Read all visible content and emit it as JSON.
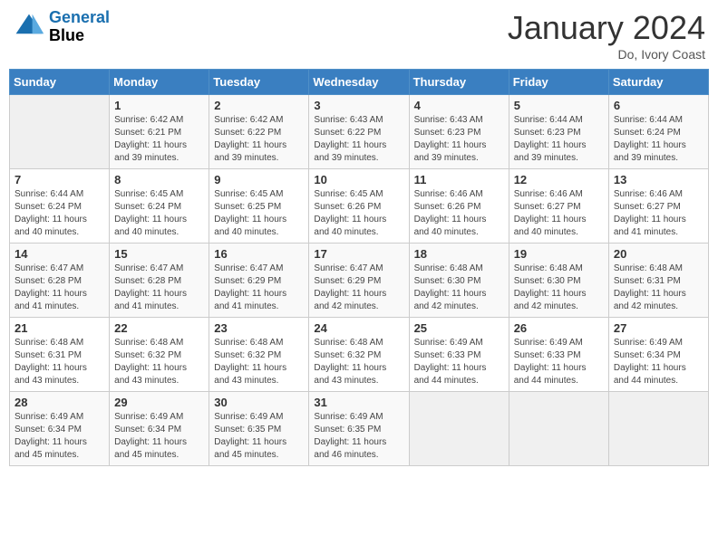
{
  "header": {
    "logo_line1": "General",
    "logo_line2": "Blue",
    "month_year": "January 2024",
    "location": "Do, Ivory Coast"
  },
  "days_of_week": [
    "Sunday",
    "Monday",
    "Tuesday",
    "Wednesday",
    "Thursday",
    "Friday",
    "Saturday"
  ],
  "weeks": [
    [
      {
        "day": "",
        "info": ""
      },
      {
        "day": "1",
        "info": "Sunrise: 6:42 AM\nSunset: 6:21 PM\nDaylight: 11 hours\nand 39 minutes."
      },
      {
        "day": "2",
        "info": "Sunrise: 6:42 AM\nSunset: 6:22 PM\nDaylight: 11 hours\nand 39 minutes."
      },
      {
        "day": "3",
        "info": "Sunrise: 6:43 AM\nSunset: 6:22 PM\nDaylight: 11 hours\nand 39 minutes."
      },
      {
        "day": "4",
        "info": "Sunrise: 6:43 AM\nSunset: 6:23 PM\nDaylight: 11 hours\nand 39 minutes."
      },
      {
        "day": "5",
        "info": "Sunrise: 6:44 AM\nSunset: 6:23 PM\nDaylight: 11 hours\nand 39 minutes."
      },
      {
        "day": "6",
        "info": "Sunrise: 6:44 AM\nSunset: 6:24 PM\nDaylight: 11 hours\nand 39 minutes."
      }
    ],
    [
      {
        "day": "7",
        "info": "Sunrise: 6:44 AM\nSunset: 6:24 PM\nDaylight: 11 hours\nand 40 minutes."
      },
      {
        "day": "8",
        "info": "Sunrise: 6:45 AM\nSunset: 6:24 PM\nDaylight: 11 hours\nand 40 minutes."
      },
      {
        "day": "9",
        "info": "Sunrise: 6:45 AM\nSunset: 6:25 PM\nDaylight: 11 hours\nand 40 minutes."
      },
      {
        "day": "10",
        "info": "Sunrise: 6:45 AM\nSunset: 6:26 PM\nDaylight: 11 hours\nand 40 minutes."
      },
      {
        "day": "11",
        "info": "Sunrise: 6:46 AM\nSunset: 6:26 PM\nDaylight: 11 hours\nand 40 minutes."
      },
      {
        "day": "12",
        "info": "Sunrise: 6:46 AM\nSunset: 6:27 PM\nDaylight: 11 hours\nand 40 minutes."
      },
      {
        "day": "13",
        "info": "Sunrise: 6:46 AM\nSunset: 6:27 PM\nDaylight: 11 hours\nand 41 minutes."
      }
    ],
    [
      {
        "day": "14",
        "info": "Sunrise: 6:47 AM\nSunset: 6:28 PM\nDaylight: 11 hours\nand 41 minutes."
      },
      {
        "day": "15",
        "info": "Sunrise: 6:47 AM\nSunset: 6:28 PM\nDaylight: 11 hours\nand 41 minutes."
      },
      {
        "day": "16",
        "info": "Sunrise: 6:47 AM\nSunset: 6:29 PM\nDaylight: 11 hours\nand 41 minutes."
      },
      {
        "day": "17",
        "info": "Sunrise: 6:47 AM\nSunset: 6:29 PM\nDaylight: 11 hours\nand 42 minutes."
      },
      {
        "day": "18",
        "info": "Sunrise: 6:48 AM\nSunset: 6:30 PM\nDaylight: 11 hours\nand 42 minutes."
      },
      {
        "day": "19",
        "info": "Sunrise: 6:48 AM\nSunset: 6:30 PM\nDaylight: 11 hours\nand 42 minutes."
      },
      {
        "day": "20",
        "info": "Sunrise: 6:48 AM\nSunset: 6:31 PM\nDaylight: 11 hours\nand 42 minutes."
      }
    ],
    [
      {
        "day": "21",
        "info": "Sunrise: 6:48 AM\nSunset: 6:31 PM\nDaylight: 11 hours\nand 43 minutes."
      },
      {
        "day": "22",
        "info": "Sunrise: 6:48 AM\nSunset: 6:32 PM\nDaylight: 11 hours\nand 43 minutes."
      },
      {
        "day": "23",
        "info": "Sunrise: 6:48 AM\nSunset: 6:32 PM\nDaylight: 11 hours\nand 43 minutes."
      },
      {
        "day": "24",
        "info": "Sunrise: 6:48 AM\nSunset: 6:32 PM\nDaylight: 11 hours\nand 43 minutes."
      },
      {
        "day": "25",
        "info": "Sunrise: 6:49 AM\nSunset: 6:33 PM\nDaylight: 11 hours\nand 44 minutes."
      },
      {
        "day": "26",
        "info": "Sunrise: 6:49 AM\nSunset: 6:33 PM\nDaylight: 11 hours\nand 44 minutes."
      },
      {
        "day": "27",
        "info": "Sunrise: 6:49 AM\nSunset: 6:34 PM\nDaylight: 11 hours\nand 44 minutes."
      }
    ],
    [
      {
        "day": "28",
        "info": "Sunrise: 6:49 AM\nSunset: 6:34 PM\nDaylight: 11 hours\nand 45 minutes."
      },
      {
        "day": "29",
        "info": "Sunrise: 6:49 AM\nSunset: 6:34 PM\nDaylight: 11 hours\nand 45 minutes."
      },
      {
        "day": "30",
        "info": "Sunrise: 6:49 AM\nSunset: 6:35 PM\nDaylight: 11 hours\nand 45 minutes."
      },
      {
        "day": "31",
        "info": "Sunrise: 6:49 AM\nSunset: 6:35 PM\nDaylight: 11 hours\nand 46 minutes."
      },
      {
        "day": "",
        "info": ""
      },
      {
        "day": "",
        "info": ""
      },
      {
        "day": "",
        "info": ""
      }
    ]
  ]
}
